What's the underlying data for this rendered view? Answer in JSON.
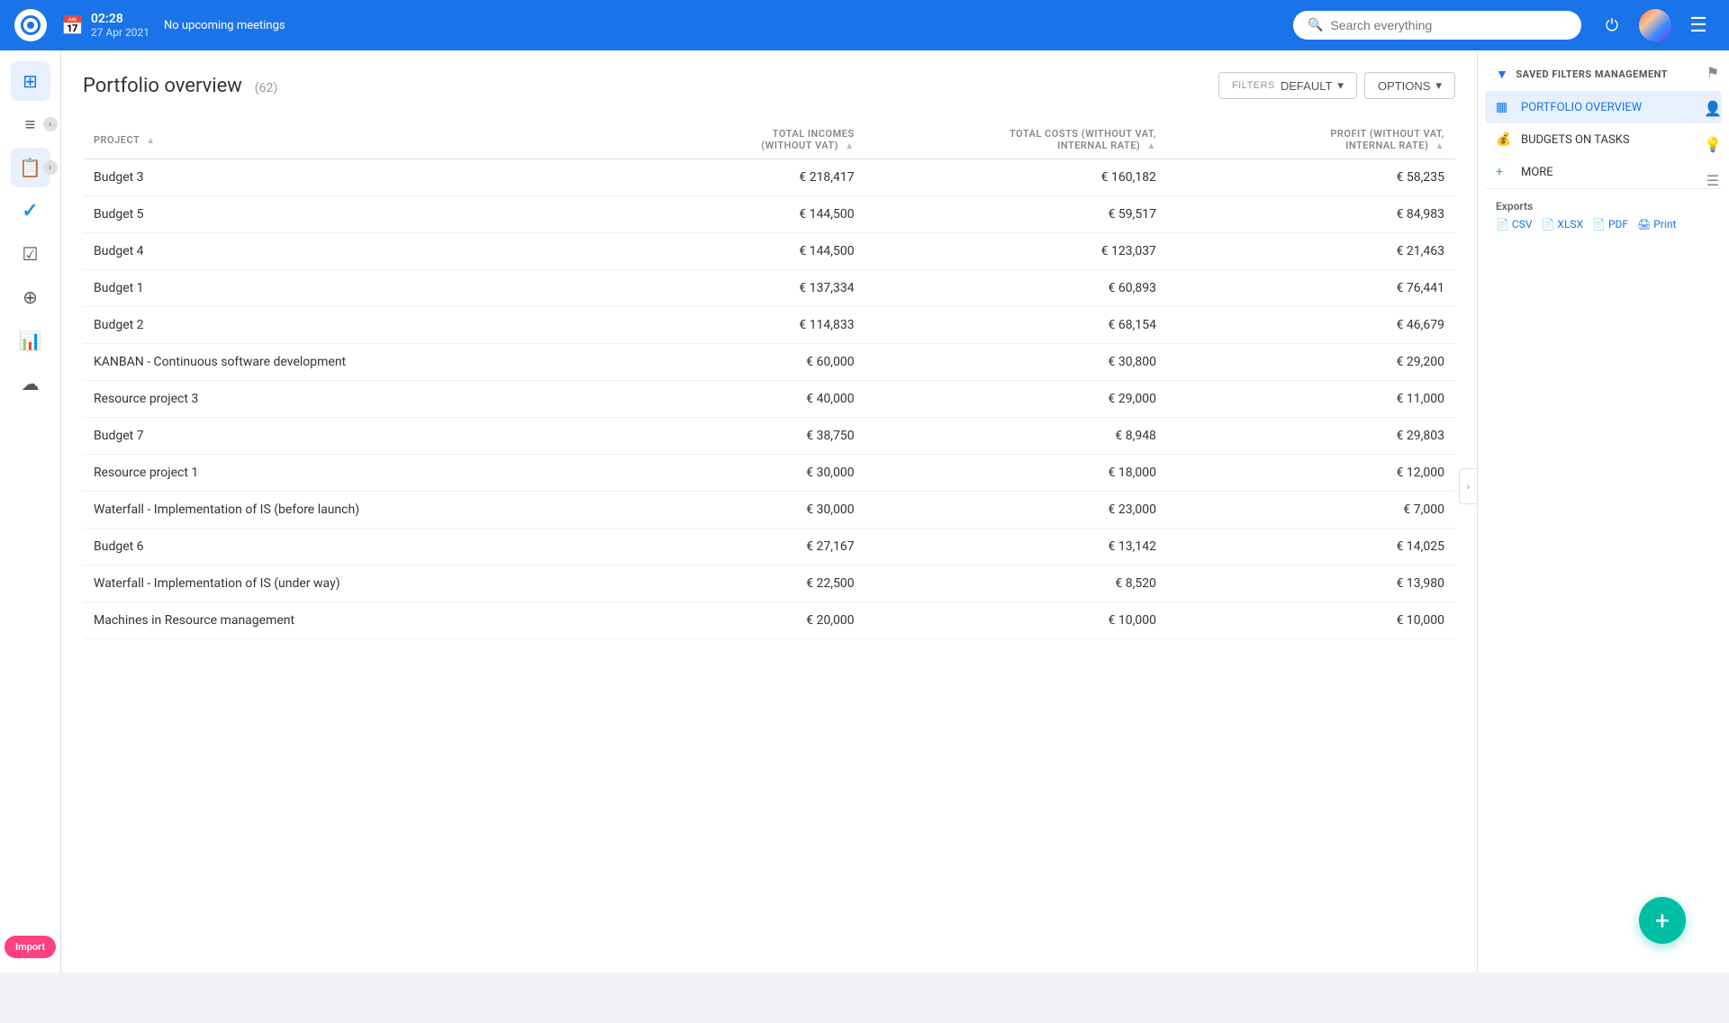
{
  "topbar": {
    "time": "02:28",
    "meeting_status": "No upcoming meetings",
    "date": "27 Apr 2021",
    "search_placeholder": "Search everything"
  },
  "sidebar": {
    "items": [
      {
        "id": "dashboard",
        "icon": "⊞",
        "active": false
      },
      {
        "id": "list-expand",
        "icon": "≡",
        "active": false,
        "expandable": true
      },
      {
        "id": "clipboard",
        "icon": "📋",
        "active": true,
        "expandable": true
      },
      {
        "id": "check",
        "icon": "✓",
        "active": false
      },
      {
        "id": "tasks",
        "icon": "☑",
        "active": false
      },
      {
        "id": "timer",
        "icon": "⊕",
        "active": false
      },
      {
        "id": "chart",
        "icon": "📊",
        "active": false
      },
      {
        "id": "cloud",
        "icon": "☁",
        "active": false
      }
    ],
    "import_label": "Import"
  },
  "page": {
    "title": "Portfolio overview",
    "count": "(62)",
    "filters_label": "FILTERS",
    "filters_value": "DEFAULT",
    "options_label": "OPTIONS"
  },
  "table": {
    "columns": [
      {
        "id": "project",
        "label": "PROJECT",
        "sortable": true
      },
      {
        "id": "total_incomes",
        "label": "TOTAL INCOMES (WITHOUT VAT)",
        "sortable": true,
        "align": "right"
      },
      {
        "id": "total_costs",
        "label": "TOTAL COSTS (WITHOUT VAT, INTERNAL RATE)",
        "sortable": true,
        "align": "right"
      },
      {
        "id": "profit",
        "label": "PROFIT (WITHOUT VAT, INTERNAL RATE)",
        "sortable": true,
        "align": "right"
      }
    ],
    "rows": [
      {
        "project": "Budget 3",
        "total_incomes": "€ 218,417",
        "total_costs": "€ 160,182",
        "profit": "€ 58,235"
      },
      {
        "project": "Budget 5",
        "total_incomes": "€ 144,500",
        "total_costs": "€ 59,517",
        "profit": "€ 84,983"
      },
      {
        "project": "Budget 4",
        "total_incomes": "€ 144,500",
        "total_costs": "€ 123,037",
        "profit": "€ 21,463"
      },
      {
        "project": "Budget 1",
        "total_incomes": "€ 137,334",
        "total_costs": "€ 60,893",
        "profit": "€ 76,441"
      },
      {
        "project": "Budget 2",
        "total_incomes": "€ 114,833",
        "total_costs": "€ 68,154",
        "profit": "€ 46,679"
      },
      {
        "project": "KANBAN - Continuous software development",
        "total_incomes": "€ 60,000",
        "total_costs": "€ 30,800",
        "profit": "€ 29,200"
      },
      {
        "project": "Resource project 3",
        "total_incomes": "€ 40,000",
        "total_costs": "€ 29,000",
        "profit": "€ 11,000"
      },
      {
        "project": "Budget 7",
        "total_incomes": "€ 38,750",
        "total_costs": "€ 8,948",
        "profit": "€ 29,803"
      },
      {
        "project": "Resource project 1",
        "total_incomes": "€ 30,000",
        "total_costs": "€ 18,000",
        "profit": "€ 12,000"
      },
      {
        "project": "Waterfall - Implementation of IS (before launch)",
        "total_incomes": "€ 30,000",
        "total_costs": "€ 23,000",
        "profit": "€ 7,000"
      },
      {
        "project": "Budget 6",
        "total_incomes": "€ 27,167",
        "total_costs": "€ 13,142",
        "profit": "€ 14,025"
      },
      {
        "project": "Waterfall - Implementation of IS (under way)",
        "total_incomes": "€ 22,500",
        "total_costs": "€ 8,520",
        "profit": "€ 13,980"
      },
      {
        "project": "Machines in Resource management",
        "total_incomes": "€ 20,000",
        "total_costs": "€ 10,000",
        "profit": "€ 10,000"
      }
    ]
  },
  "right_panel": {
    "saved_filters_title": "SAVED FILTERS MANAGEMENT",
    "menu_items": [
      {
        "id": "portfolio-overview",
        "label": "PORTFOLIO OVERVIEW",
        "icon": "▦",
        "active": true
      },
      {
        "id": "budgets-on-tasks",
        "label": "BUDGETS ON TASKS",
        "icon": "💰",
        "active": false
      },
      {
        "id": "more",
        "label": "MORE",
        "icon": "+",
        "active": false
      }
    ],
    "side_icons": [
      {
        "id": "flag",
        "icon": "⚑"
      },
      {
        "id": "person-search",
        "icon": "👤"
      },
      {
        "id": "lightbulb",
        "icon": "💡"
      },
      {
        "id": "task-list",
        "icon": "☰"
      }
    ],
    "exports": {
      "title": "Exports",
      "links": [
        "CSV",
        "XLSX",
        "PDF",
        "Print"
      ]
    }
  },
  "fab": {
    "icon": "+"
  }
}
